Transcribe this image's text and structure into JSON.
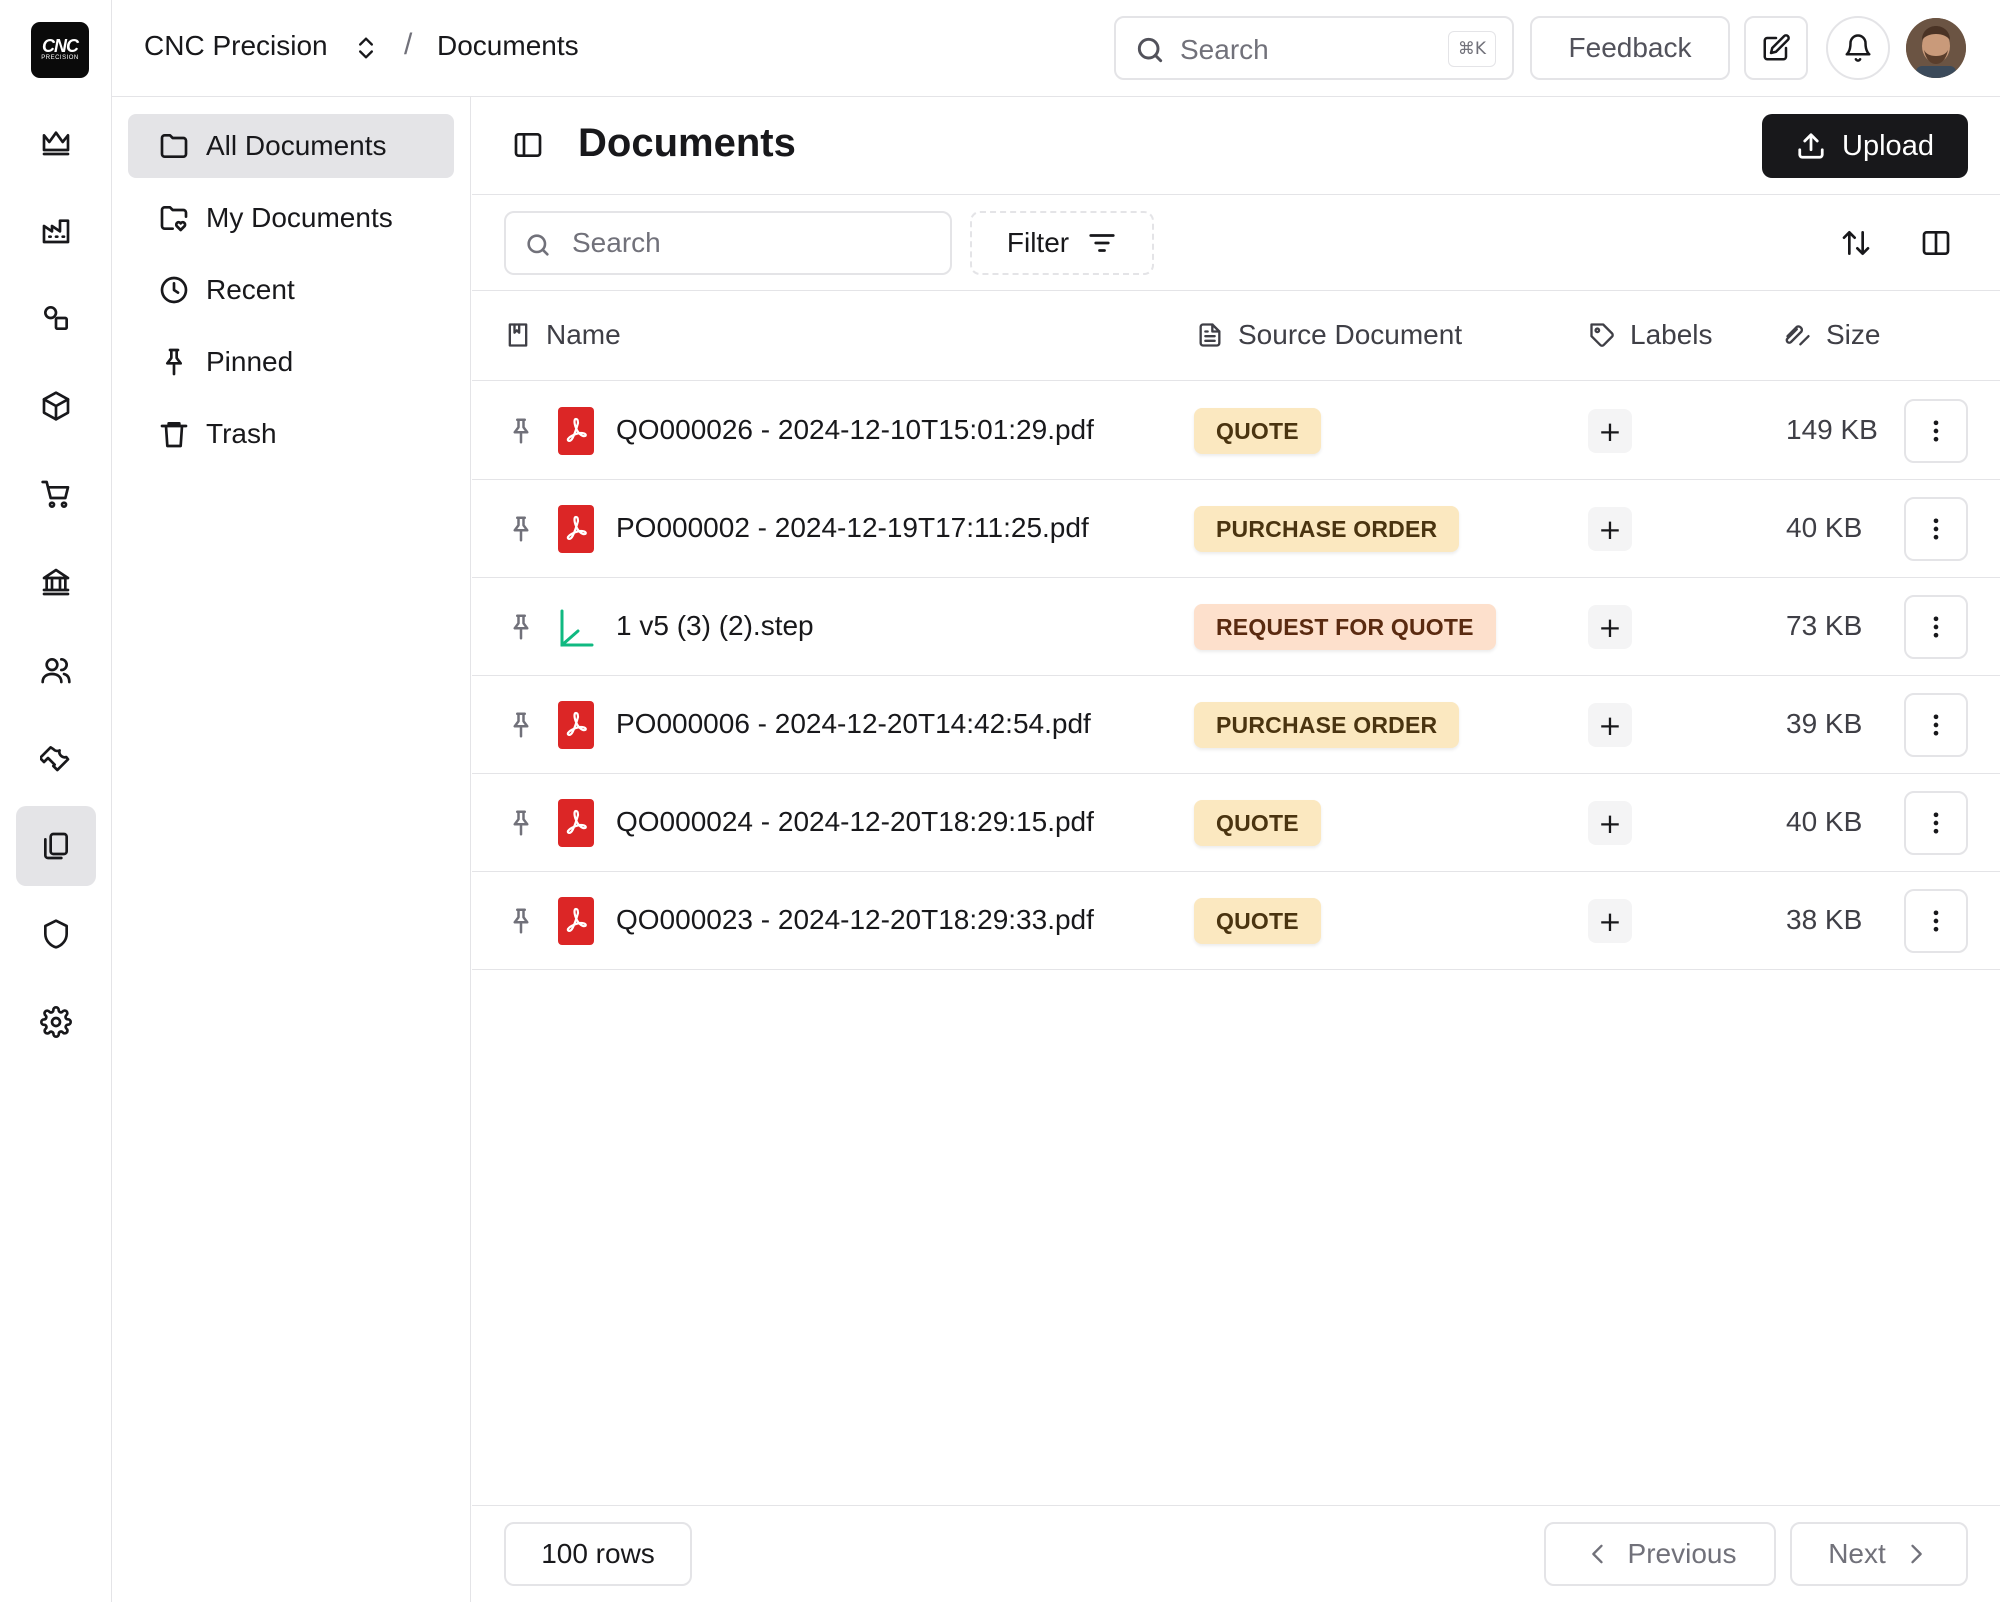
{
  "app": {
    "logo_top": "CNC",
    "logo_bottom": "PRECISION",
    "company": "CNC Precision",
    "breadcrumb_sep": "/",
    "page": "Documents"
  },
  "topbar": {
    "search_placeholder": "Search",
    "search_shortcut": "⌘K",
    "feedback_label": "Feedback"
  },
  "rail": {
    "items": [
      "crown-icon",
      "factory-icon",
      "shapes-icon",
      "cube-icon",
      "cart-icon",
      "bank-icon",
      "users-icon",
      "wrench-icon",
      "documents-icon",
      "shield-icon",
      "gear-icon"
    ],
    "active": "documents-icon"
  },
  "nav": {
    "items": [
      {
        "label": "All Documents",
        "icon": "folder-icon",
        "active": true
      },
      {
        "label": "My Documents",
        "icon": "folder-heart-icon"
      },
      {
        "label": "Recent",
        "icon": "clock-icon"
      },
      {
        "label": "Pinned",
        "icon": "pin-icon"
      },
      {
        "label": "Trash",
        "icon": "trash-icon"
      }
    ]
  },
  "main": {
    "title": "Documents",
    "upload_label": "Upload",
    "search_placeholder": "Search",
    "filter_label": "Filter"
  },
  "table": {
    "columns": {
      "name": "Name",
      "source": "Source Document",
      "labels": "Labels",
      "size": "Size"
    },
    "rows": [
      {
        "name": "QO000026 - 2024-12-10T15:01:29.pdf",
        "type": "pdf",
        "source": "QUOTE",
        "labels_add": "+",
        "size": "149 KB"
      },
      {
        "name": "PO000002 - 2024-12-19T17:11:25.pdf",
        "type": "pdf",
        "source": "PURCHASE ORDER",
        "labels_add": "+",
        "size": "40 KB"
      },
      {
        "name": "1 v5 (3) (2).step",
        "type": "step",
        "source": "REQUEST FOR QUOTE",
        "labels_add": "+",
        "size": "73 KB"
      },
      {
        "name": "PO000006 - 2024-12-20T14:42:54.pdf",
        "type": "pdf",
        "source": "PURCHASE ORDER",
        "labels_add": "+",
        "size": "39 KB"
      },
      {
        "name": "QO000024 - 2024-12-20T18:29:15.pdf",
        "type": "pdf",
        "source": "QUOTE",
        "labels_add": "+",
        "size": "40 KB"
      },
      {
        "name": "QO000023 - 2024-12-20T18:29:33.pdf",
        "type": "pdf",
        "source": "QUOTE",
        "labels_add": "+",
        "size": "38 KB"
      }
    ]
  },
  "footer": {
    "rows_label": "100 rows",
    "previous_label": "Previous",
    "next_label": "Next"
  },
  "colors": {
    "accent": "#18181b",
    "pdf_red": "#dc2626",
    "step_green": "#10b981",
    "badge_quote": "#fbe8c0",
    "badge_rfq": "#fde0cc"
  }
}
